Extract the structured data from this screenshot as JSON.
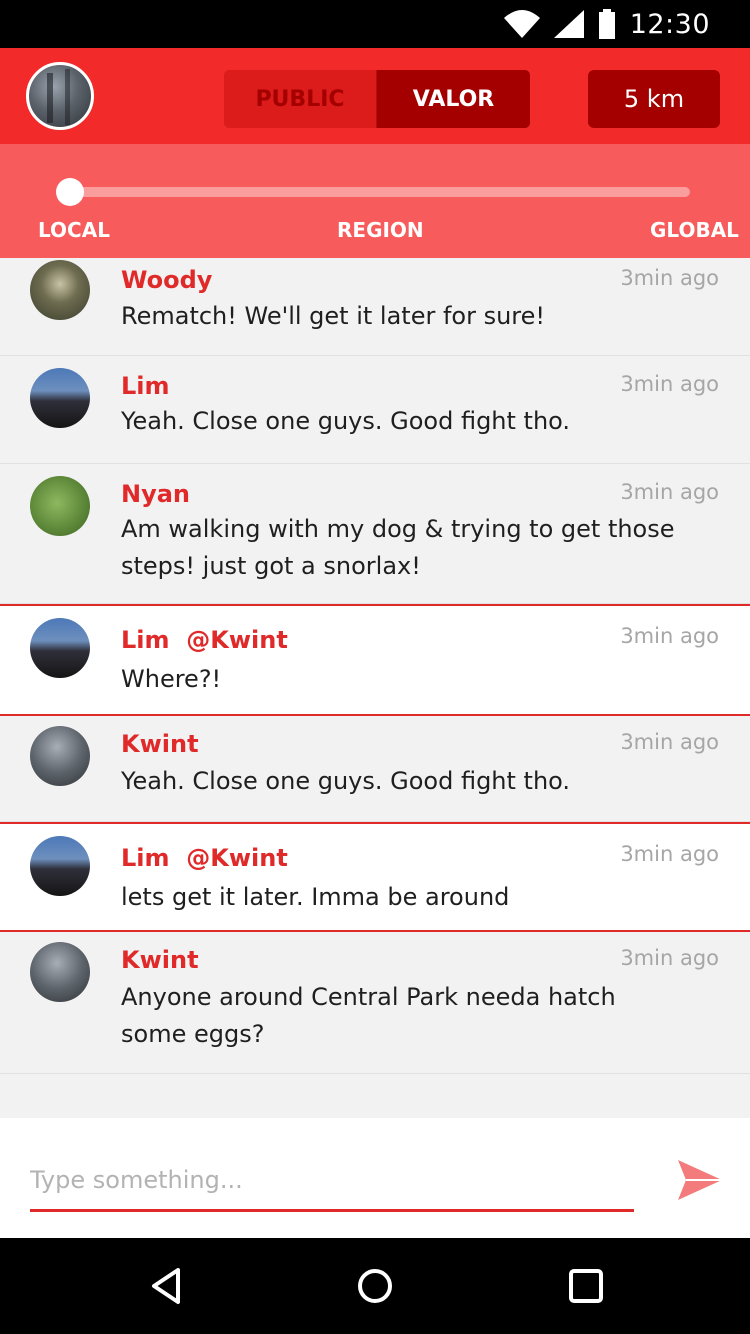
{
  "status_bar": {
    "time": "12:30"
  },
  "header": {
    "tabs": [
      {
        "label": "PUBLIC",
        "active": false
      },
      {
        "label": "VALOR",
        "active": true
      }
    ],
    "distance": "5 km"
  },
  "range_slider": {
    "labels": [
      "LOCAL",
      "REGION",
      "GLOBAL"
    ],
    "selected": "LOCAL",
    "value": 0
  },
  "messages": [
    {
      "author": "Woody",
      "mention": "",
      "time": "3min ago",
      "text": "Rematch! We'll get it later for sure!"
    },
    {
      "author": "Lim",
      "mention": "",
      "time": "3min ago",
      "text": "Yeah. Close one guys. Good fight tho."
    },
    {
      "author": "Nyan",
      "mention": "",
      "time": "3min ago",
      "text": "Am walking with my dog & trying to get those steps!  just got a snorlax!"
    },
    {
      "author": "Lim",
      "mention": "@Kwint",
      "time": "3min ago",
      "text": "Where?!"
    },
    {
      "author": "Kwint",
      "mention": "",
      "time": "3min ago",
      "text": "Yeah. Close one guys. Good fight tho."
    },
    {
      "author": "Lim",
      "mention": "@Kwint",
      "time": "3min ago",
      "text": "lets get it later. Imma be around"
    },
    {
      "author": "Kwint",
      "mention": "",
      "time": "3min ago",
      "text": "Anyone around Central Park needa hatch some eggs?"
    }
  ],
  "composer": {
    "placeholder": "Type something...",
    "value": ""
  },
  "colors": {
    "primary": "#f32a2a",
    "dark": "#a50000",
    "light": "#f75b5b",
    "name": "#e02a2a"
  },
  "icons": [
    "wifi-icon",
    "signal-icon",
    "battery-icon",
    "send-icon",
    "back-icon",
    "home-icon",
    "recents-icon"
  ]
}
